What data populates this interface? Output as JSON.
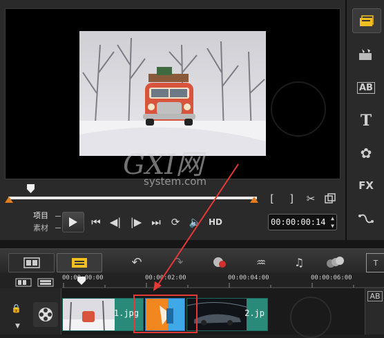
{
  "preview": {
    "watermark_brand": "GXI网",
    "watermark_site": "system.com"
  },
  "controls": {
    "mode_project": "项目",
    "mode_clip": "素材",
    "hd_label": "HD",
    "timecode": "00:00:00:",
    "timecode_frame": "14"
  },
  "timeline": {
    "ruler": [
      "00:00:00:00",
      "00:00:02:00",
      "00:00:04:00",
      "00:00:06:00"
    ],
    "zoom_label": "+/−",
    "clips": [
      {
        "label": "1.jpg"
      },
      {
        "label": ""
      },
      {
        "label": "2.jp"
      }
    ]
  },
  "side_panel": {
    "title_label": "AB",
    "fx_label": "FX",
    "text_label": "T"
  },
  "colors": {
    "accent": "#f0c020",
    "trim": "#e57c1d",
    "highlight": "#e53935",
    "clip_green": "#2a8a7a"
  }
}
